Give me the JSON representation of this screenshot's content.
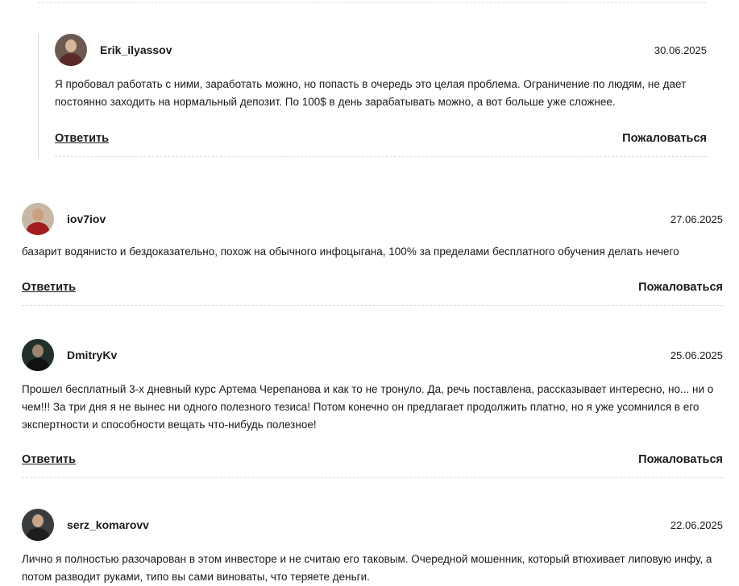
{
  "comments": [
    {
      "username": "Erik_ilyassov",
      "date": "30.06.2025",
      "text": "Я пробовал работать с ними, заработать можно, но попасть в очередь это целая проблема. Ограничение по людям, не дает постоянно заходить на нормальный депозит. По 100$ в день зарабатывать можно, а вот больше уже сложнее.",
      "reply_label": "Ответить",
      "report_label": "Пожаловаться",
      "avatar": "user-avatar-icon",
      "avatar_bg": "#6b5a50",
      "avatar_shirt": "#5a2a2a",
      "avatar_skin": "#d8b49a"
    },
    {
      "username": "iov7iov",
      "date": "27.06.2025",
      "text": "базарит водянисто и бездоказательно, похож на обычного инфоцыгана, 100% за пределами бесплатного обучения делать нечего",
      "reply_label": "Ответить",
      "report_label": "Пожаловаться",
      "avatar": "user-avatar-icon",
      "avatar_bg": "#c7b8a6",
      "avatar_shirt": "#a31d1d",
      "avatar_skin": "#caa07e"
    },
    {
      "username": "DmitryKv",
      "date": "25.06.2025",
      "text": "Прошел бесплатный 3-х дневный курс Артема Черепанова и как то не тронуло. Да, речь поставлена, рассказывает интересно, но... ни о чем!!! За три дня я не вынес ни одного полезного тезиса! Потом конечно он предлагает продолжить платно, но я уже усомнился в его экспертности и способности вещать что-нибудь полезное!",
      "reply_label": "Ответить",
      "report_label": "Пожаловаться",
      "avatar": "user-avatar-icon",
      "avatar_bg": "#22302a",
      "avatar_shirt": "#111111",
      "avatar_skin": "#9c8570"
    },
    {
      "username": "serz_komarovv",
      "date": "22.06.2025",
      "text": "Лично я полностью разочарован в этом инвесторе и не считаю его таковым. Очередной мошенник, который втюхивает липовую инфу, а потом разводит руками, типо вы сами виноваты, что теряете деньги.",
      "avatar": "user-avatar-icon",
      "avatar_bg": "#3a3d40",
      "avatar_shirt": "#1d1d1d",
      "avatar_skin": "#c9a488"
    }
  ]
}
